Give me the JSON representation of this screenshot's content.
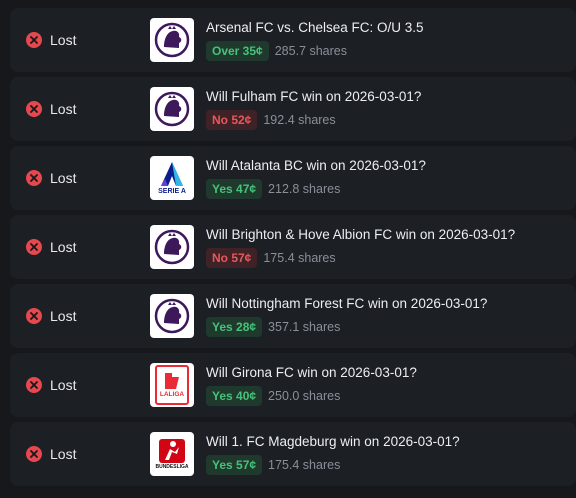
{
  "colors": {
    "background": "#16181c",
    "row": "#1c1f24",
    "lost": "#e5484d",
    "yes_over": "#46c27a",
    "no": "#e5595e",
    "premier_league": "#3d195b",
    "serie_a": "#0c1e8a",
    "laliga": "#ea2b35",
    "bundesliga": "#d20515"
  },
  "bets": [
    {
      "status": "Lost",
      "logo": "premier-league-logo",
      "logo_text": "",
      "question": "Arsenal FC vs. Chelsea FC: O/U 3.5",
      "outcome": "Over 35¢",
      "outcome_kind": "green",
      "shares": "285.7 shares"
    },
    {
      "status": "Lost",
      "logo": "premier-league-logo",
      "logo_text": "",
      "question": "Will Fulham FC win on 2026-03-01?",
      "outcome": "No 52¢",
      "outcome_kind": "red",
      "shares": "192.4 shares"
    },
    {
      "status": "Lost",
      "logo": "serie-a-logo",
      "logo_text": "SERIE A",
      "question": "Will Atalanta BC win on 2026-03-01?",
      "outcome": "Yes 47¢",
      "outcome_kind": "green",
      "shares": "212.8 shares"
    },
    {
      "status": "Lost",
      "logo": "premier-league-logo",
      "logo_text": "",
      "question": "Will Brighton & Hove Albion FC win on 2026-03-01?",
      "outcome": "No 57¢",
      "outcome_kind": "red",
      "shares": "175.4 shares"
    },
    {
      "status": "Lost",
      "logo": "premier-league-logo",
      "logo_text": "",
      "question": "Will Nottingham Forest FC win on 2026-03-01?",
      "outcome": "Yes 28¢",
      "outcome_kind": "green",
      "shares": "357.1 shares"
    },
    {
      "status": "Lost",
      "logo": "laliga-logo",
      "logo_text": "LALIGA",
      "question": "Will Girona FC win on 2026-03-01?",
      "outcome": "Yes 40¢",
      "outcome_kind": "green",
      "shares": "250.0 shares"
    },
    {
      "status": "Lost",
      "logo": "bundesliga-logo",
      "logo_text": "BUNDESLIGA",
      "question": "Will 1. FC Magdeburg win on 2026-03-01?",
      "outcome": "Yes 57¢",
      "outcome_kind": "green",
      "shares": "175.4 shares"
    }
  ]
}
